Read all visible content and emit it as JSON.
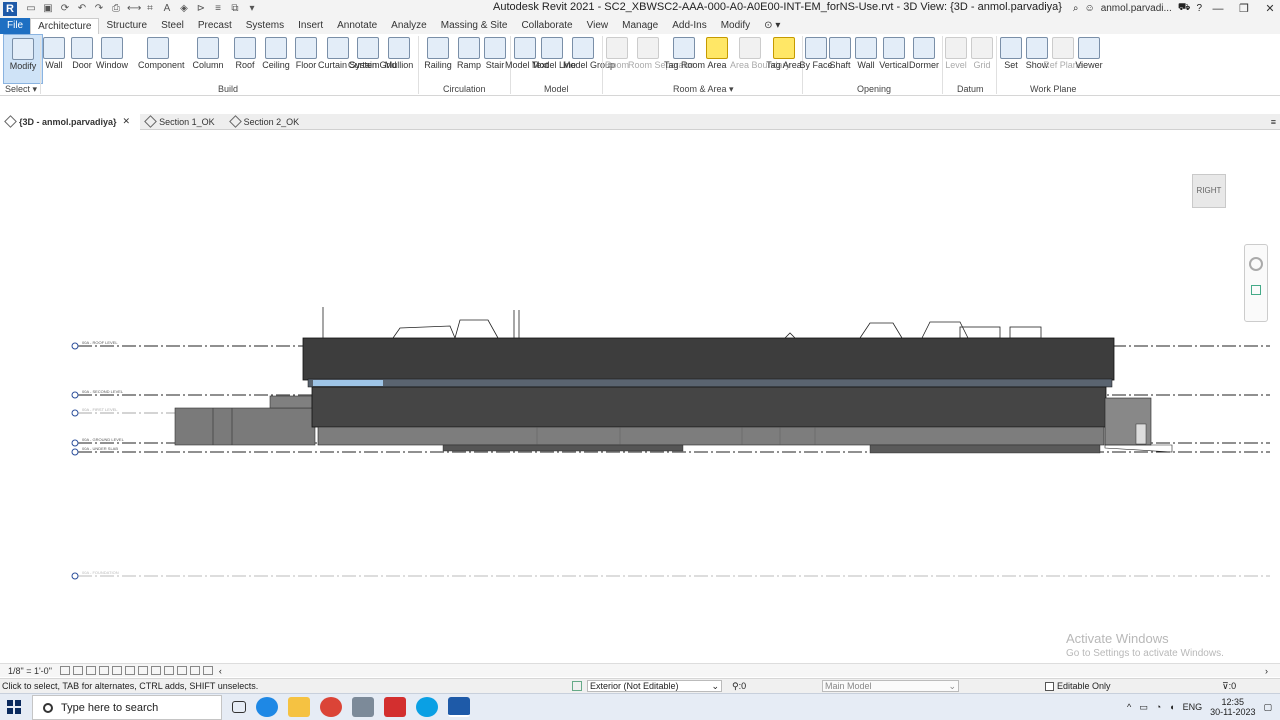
{
  "app": {
    "logo": "R",
    "title": "Autodesk Revit 2021 - SC2_XBWSC2-AAA-000-A0-A0E00-INT-EM_forNS-Use.rvt - 3D View: {3D - anmol.parvadiya}",
    "user": "anmol.parvadi...",
    "window_buttons": [
      "—",
      "❐",
      "✕"
    ]
  },
  "ribbon_tabs": [
    "File",
    "Architecture",
    "Structure",
    "Steel",
    "Precast",
    "Systems",
    "Insert",
    "Annotate",
    "Analyze",
    "Massing & Site",
    "Collaborate",
    "View",
    "Manage",
    "Add-Ins",
    "Modify"
  ],
  "active_tab": "Architecture",
  "ribbon": {
    "buttons": [
      {
        "label": "Modify",
        "icon": "cursor-icon"
      },
      {
        "label": "Wall",
        "icon": "wall-icon"
      },
      {
        "label": "Door",
        "icon": "door-icon"
      },
      {
        "label": "Window",
        "icon": "window-icon"
      },
      {
        "label": "Component",
        "icon": "component-icon"
      },
      {
        "label": "Column",
        "icon": "column-icon"
      },
      {
        "label": "Roof",
        "icon": "roof-icon"
      },
      {
        "label": "Ceiling",
        "icon": "ceiling-icon"
      },
      {
        "label": "Floor",
        "icon": "floor-icon"
      },
      {
        "label": "Curtain System",
        "icon": "curtain-system-icon"
      },
      {
        "label": "Curtain Grid",
        "icon": "curtain-grid-icon"
      },
      {
        "label": "Mullion",
        "icon": "mullion-icon"
      },
      {
        "label": "Railing",
        "icon": "railing-icon"
      },
      {
        "label": "Ramp",
        "icon": "ramp-icon"
      },
      {
        "label": "Stair",
        "icon": "stair-icon"
      },
      {
        "label": "Model Text",
        "icon": "model-text-icon"
      },
      {
        "label": "Model Line",
        "icon": "model-line-icon"
      },
      {
        "label": "Model Group",
        "icon": "model-group-icon"
      },
      {
        "label": "Room",
        "icon": "room-icon"
      },
      {
        "label": "Room Separator",
        "icon": "room-separator-icon"
      },
      {
        "label": "Tag Room",
        "icon": "tag-room-icon"
      },
      {
        "label": "Area",
        "icon": "area-icon"
      },
      {
        "label": "Area Boundary",
        "icon": "area-boundary-icon"
      },
      {
        "label": "Tag Area",
        "icon": "tag-area-icon"
      },
      {
        "label": "By Face",
        "icon": "by-face-icon"
      },
      {
        "label": "Shaft",
        "icon": "shaft-icon"
      },
      {
        "label": "Wall",
        "icon": "wall-opening-icon"
      },
      {
        "label": "Vertical",
        "icon": "vertical-icon"
      },
      {
        "label": "Dormer",
        "icon": "dormer-icon"
      },
      {
        "label": "Level",
        "icon": "level-icon"
      },
      {
        "label": "Grid",
        "icon": "grid-icon"
      },
      {
        "label": "Set",
        "icon": "set-icon"
      },
      {
        "label": "Show",
        "icon": "show-icon"
      },
      {
        "label": "Ref Plane",
        "icon": "ref-plane-icon"
      },
      {
        "label": "Viewer",
        "icon": "viewer-icon"
      }
    ],
    "panels": [
      "Select",
      "Build",
      "Circulation",
      "Model",
      "Room & Area",
      "Opening",
      "Datum",
      "Work Plane"
    ]
  },
  "view_tabs": [
    {
      "label": "{3D - anmol.parvadiya}",
      "active": true
    },
    {
      "label": "Section 1_OK",
      "active": false
    },
    {
      "label": "Section 2_OK",
      "active": false
    }
  ],
  "canvas": {
    "viewcube_label": "RIGHT",
    "level_labels": [
      "00A - ROOF LEVEL",
      "00A - SECOND LEVEL",
      "00A - FIRST LEVEL",
      "00A - GROUND LEVEL",
      "00A - UNDER SLAB",
      "00A - FOUNDATION"
    ],
    "watermark_title": "Activate Windows",
    "watermark_sub": "Go to Settings to activate Windows."
  },
  "view_control": {
    "scale": "1/8\" = 1'-0\""
  },
  "status": {
    "message": "Click to select, TAB for alternates, CTRL adds, SHIFT unselects.",
    "workset": "Exterior (Not Editable)",
    "selection_count": ":0",
    "design_option": "Main Model",
    "editable_only": "Editable Only",
    "filter_count": ":0"
  },
  "taskbar": {
    "search_placeholder": "Type here to search",
    "lang": "ENG",
    "time": "12:35",
    "date": "30-11-2023"
  },
  "colors": {
    "accent": "#1e6fc2",
    "building_dark": "#3d3d3d",
    "building_mid": "#6e6e6e",
    "level_line": "#1a1a1a"
  }
}
